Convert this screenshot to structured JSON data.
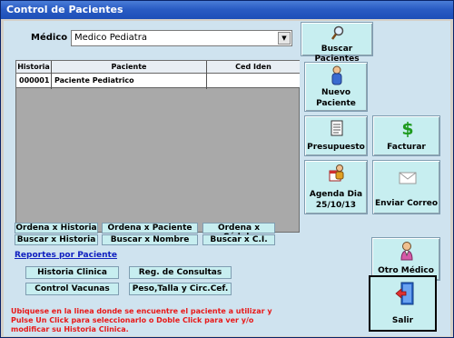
{
  "window": {
    "title": "Control de Pacientes"
  },
  "medico": {
    "label": "Médico",
    "value": "Medico Pediatra"
  },
  "grid": {
    "columns": [
      "Historia",
      "Paciente",
      "Ced Iden"
    ],
    "rows": [
      {
        "historia": "000001",
        "paciente": "Paciente Pediatrico",
        "ced": ""
      }
    ]
  },
  "buttons": {
    "buscar_pacientes": "Buscar Pacientes",
    "nuevo_paciente_1": "Nuevo",
    "nuevo_paciente_2": "Paciente",
    "presupuesto": "Presupuesto",
    "facturar": "Facturar",
    "agenda_1": "Agenda Dia",
    "agenda_2": "25/10/13",
    "enviar_correo": "Enviar Correo",
    "otro_medico": "Otro Médico",
    "salir": "Salir",
    "ordena_historia": "Ordena x Historia",
    "ordena_paciente": "Ordena x Paciente",
    "ordena_cedula": "Ordena x Cédula",
    "buscar_historia": "Buscar x Historia",
    "buscar_nombre": "Buscar x Nombre",
    "buscar_ci": "Buscar x C.I.",
    "historia_clinica": "Historia Clinica",
    "reg_consultas": "Reg. de Consultas",
    "control_vacunas": "Control Vacunas",
    "peso_talla": "Peso,Talla y Circ.Cef."
  },
  "reportes_link": "Reportes por Paciente",
  "message": "Ubiquese en la linea donde se encuentre el paciente a utilizar y Pulse Un Click para seleccionarlo o Doble Click para ver y/o modificar su Historia Clinica."
}
